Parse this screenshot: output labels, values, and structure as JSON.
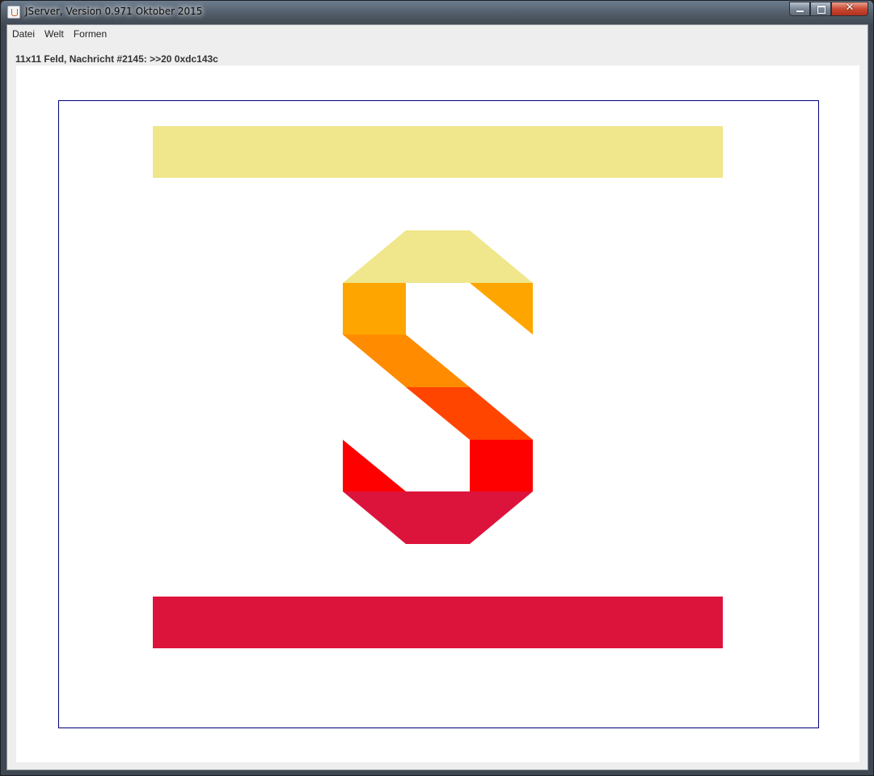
{
  "window": {
    "title": "JServer, Version 0.971 Oktober 2015",
    "controls": [
      "minimize",
      "maximize",
      "close"
    ],
    "close_glyph": "✕"
  },
  "menubar": {
    "items": [
      "Datei",
      "Welt",
      "Formen"
    ]
  },
  "status": {
    "text": "11x11 Feld, Nachricht #2145: >>20 0xdc143c"
  },
  "board": {
    "grid_size": "11x11",
    "frame_color": "#000080",
    "background": "#ffffff",
    "colors": {
      "khaki": "#f0e68c",
      "orange": "#ffa500",
      "darkorange": "#ff8c00",
      "orangered": "#ff4500",
      "red": "#ff0000",
      "crimson": "#dc143c"
    },
    "shapes": [
      {
        "name": "top-bar",
        "color": "khaki"
      },
      {
        "name": "s-top-cap",
        "color": "khaki"
      },
      {
        "name": "s-upper-left-block",
        "color": "orange"
      },
      {
        "name": "s-upper-right-triangle",
        "color": "orange"
      },
      {
        "name": "s-diagonal-upper",
        "color": "darkorange"
      },
      {
        "name": "s-diagonal-lower",
        "color": "orangered"
      },
      {
        "name": "s-lower-right-block",
        "color": "red"
      },
      {
        "name": "s-lower-left-triangle",
        "color": "red"
      },
      {
        "name": "s-bottom-cap",
        "color": "crimson"
      },
      {
        "name": "bottom-bar",
        "color": "crimson"
      }
    ]
  }
}
